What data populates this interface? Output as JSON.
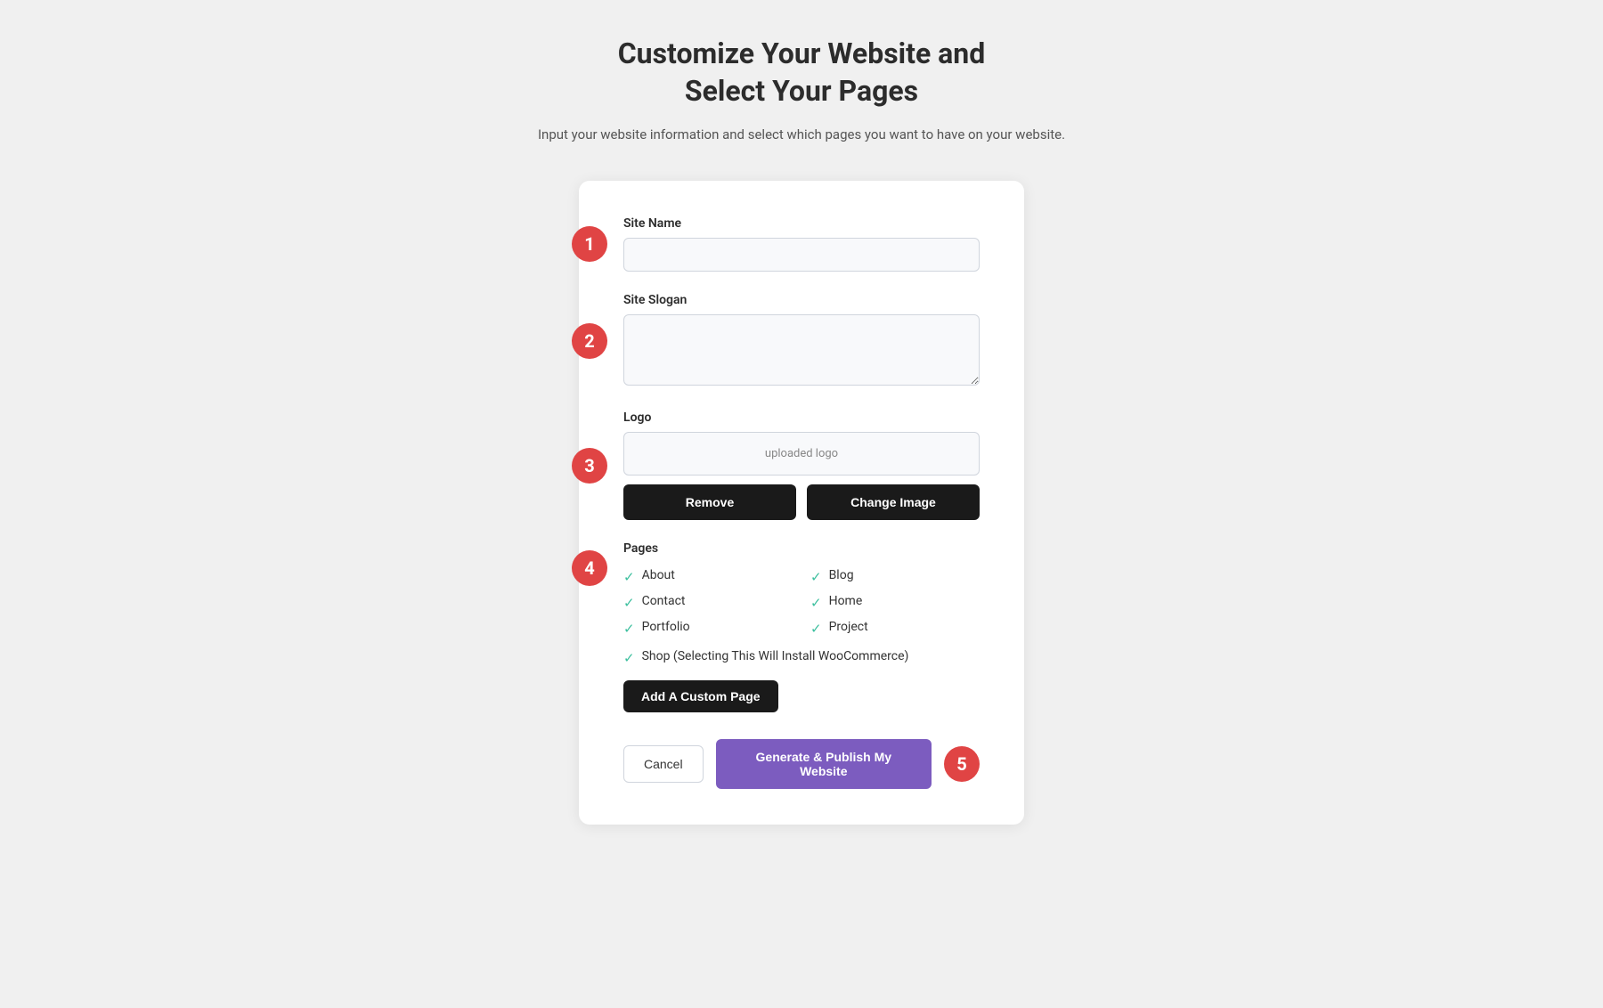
{
  "header": {
    "title_line1": "Customize Your Website and",
    "title_line2": "Select Your Pages",
    "subtitle": "Input your website information and select which pages you want to have on your website."
  },
  "steps": {
    "1": "1",
    "2": "2",
    "3": "3",
    "4": "4",
    "5": "5"
  },
  "form": {
    "site_name_label": "Site Name",
    "site_name_placeholder": "",
    "site_slogan_label": "Site Slogan",
    "site_slogan_placeholder": "",
    "logo_label": "Logo",
    "logo_preview_text": "uploaded logo",
    "remove_button": "Remove",
    "change_image_button": "Change Image",
    "pages_label": "Pages",
    "pages": [
      {
        "label": "About",
        "checked": true,
        "col": 1
      },
      {
        "label": "Blog",
        "checked": true,
        "col": 2
      },
      {
        "label": "Contact",
        "checked": true,
        "col": 1
      },
      {
        "label": "Home",
        "checked": true,
        "col": 2
      },
      {
        "label": "Portfolio",
        "checked": true,
        "col": 1
      },
      {
        "label": "Project",
        "checked": true,
        "col": 2
      }
    ],
    "shop_label": "Shop (Selecting This Will Install WooCommerce)",
    "shop_checked": true,
    "add_custom_page_button": "Add A Custom Page",
    "cancel_button": "Cancel",
    "generate_button": "Generate & Publish My Website"
  }
}
